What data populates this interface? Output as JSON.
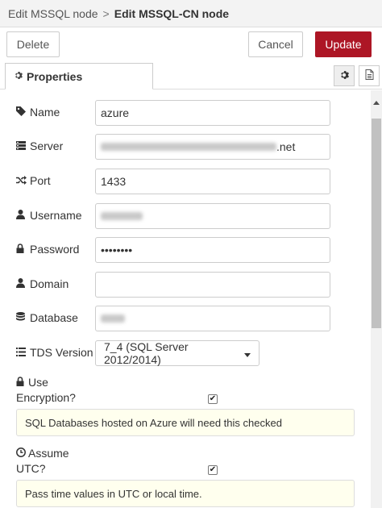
{
  "breadcrumb": {
    "parent": "Edit MSSQL node",
    "separator": ">",
    "current": "Edit MSSQL-CN node"
  },
  "toolbar": {
    "delete_label": "Delete",
    "cancel_label": "Cancel",
    "update_label": "Update"
  },
  "tabs": {
    "properties_label": "Properties"
  },
  "fields": {
    "name": {
      "label": "Name",
      "value": "azure",
      "icon": "tag-icon"
    },
    "server": {
      "label": "Server",
      "value_suffix": ".net",
      "icon": "server-icon"
    },
    "port": {
      "label": "Port",
      "value": "1433",
      "icon": "random-icon"
    },
    "username": {
      "label": "Username",
      "icon": "user-icon"
    },
    "password": {
      "label": "Password",
      "value": "••••••••",
      "icon": "lock-icon"
    },
    "domain": {
      "label": "Domain",
      "value": "",
      "icon": "user-icon"
    },
    "database": {
      "label": "Database",
      "icon": "database-icon"
    },
    "tds_version": {
      "label": "TDS Version",
      "selected": "7_4 (SQL Server 2012/2014)",
      "icon": "list-icon"
    }
  },
  "encryption": {
    "label_line1": "Use",
    "label_line2": "Encryption?",
    "checked": true,
    "tip": "SQL Databases hosted on Azure will need this checked"
  },
  "utc": {
    "label_line1": "Assume",
    "label_line2": "UTC?",
    "checked": true,
    "tip": "Pass time values in UTC or local time."
  },
  "colors": {
    "update_button": "#ad1625",
    "tip_background": "#ffffee"
  }
}
